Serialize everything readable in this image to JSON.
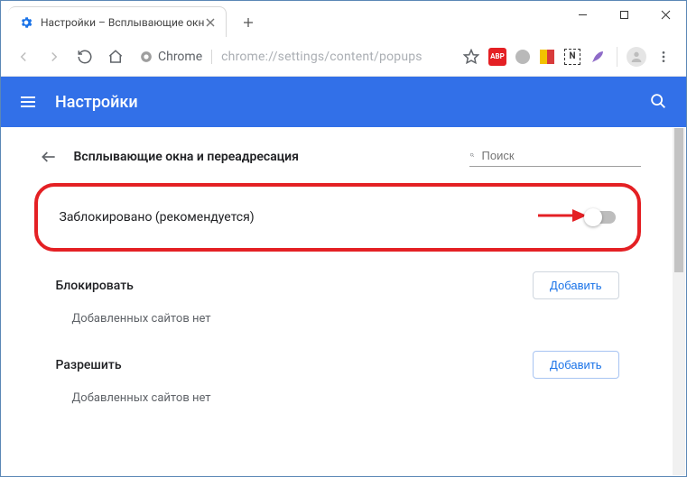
{
  "window": {
    "tab_title": "Настройки – Всплывающие окн",
    "url_chip": "Chrome",
    "url_path": "chrome://settings/content/popups"
  },
  "header": {
    "title": "Настройки"
  },
  "panel": {
    "title": "Всплывающие окна и переадресация",
    "search_placeholder": "Поиск",
    "toggle_label": "Заблокировано (рекомендуется)"
  },
  "sections": {
    "block": {
      "label": "Блокировать",
      "add_btn": "Добавить",
      "empty": "Добавленных сайтов нет"
    },
    "allow": {
      "label": "Разрешить",
      "add_btn": "Добавить",
      "empty": "Добавленных сайтов нет"
    }
  },
  "extensions": {
    "abp": "ABP",
    "n": "N"
  }
}
